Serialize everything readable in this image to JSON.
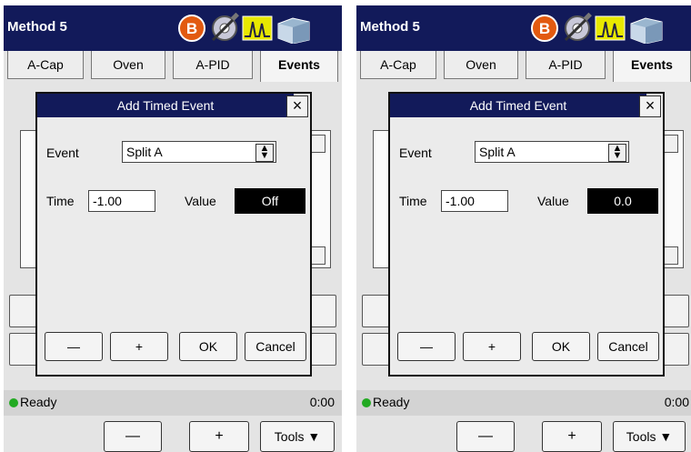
{
  "panels": [
    {
      "title": "Method 5",
      "tabs": [
        "A-Cap",
        "Oven",
        "A-PID",
        "Events"
      ],
      "active_tab": "Events",
      "dialog": {
        "title": "Add Timed Event",
        "close": "×",
        "event_label": "Event",
        "event_value": "Split A",
        "time_label": "Time",
        "time_value": "-1.00",
        "value_label": "Value",
        "value_value": "Off",
        "minus": "—",
        "plus": "+",
        "ok": "OK",
        "cancel": "Cancel"
      },
      "status": {
        "text": "Ready",
        "time": "0:00"
      },
      "bottom": {
        "minus": "—",
        "plus": "+",
        "tools": "Tools ▼"
      }
    },
    {
      "title": "Method 5",
      "tabs": [
        "A-Cap",
        "Oven",
        "A-PID",
        "Events"
      ],
      "active_tab": "Events",
      "dialog": {
        "title": "Add Timed Event",
        "close": "×",
        "event_label": "Event",
        "event_value": "Split A",
        "time_label": "Time",
        "time_value": "-1.00",
        "value_label": "Value",
        "value_value": "0.0",
        "minus": "—",
        "plus": "+",
        "ok": "OK",
        "cancel": "Cancel"
      },
      "status": {
        "text": "Ready",
        "time": "0:00"
      },
      "bottom": {
        "minus": "—",
        "plus": "+",
        "tools": "Tools ▼"
      }
    }
  ],
  "icons": [
    "b-circle-icon",
    "syringe-gear-icon",
    "chromatogram-icon",
    "instrument-icon"
  ],
  "colors": {
    "titlebar": "#121a5a",
    "status_dot": "#22aa22",
    "icon_b": "#e25a10",
    "icon_peak": "#e8e800"
  }
}
